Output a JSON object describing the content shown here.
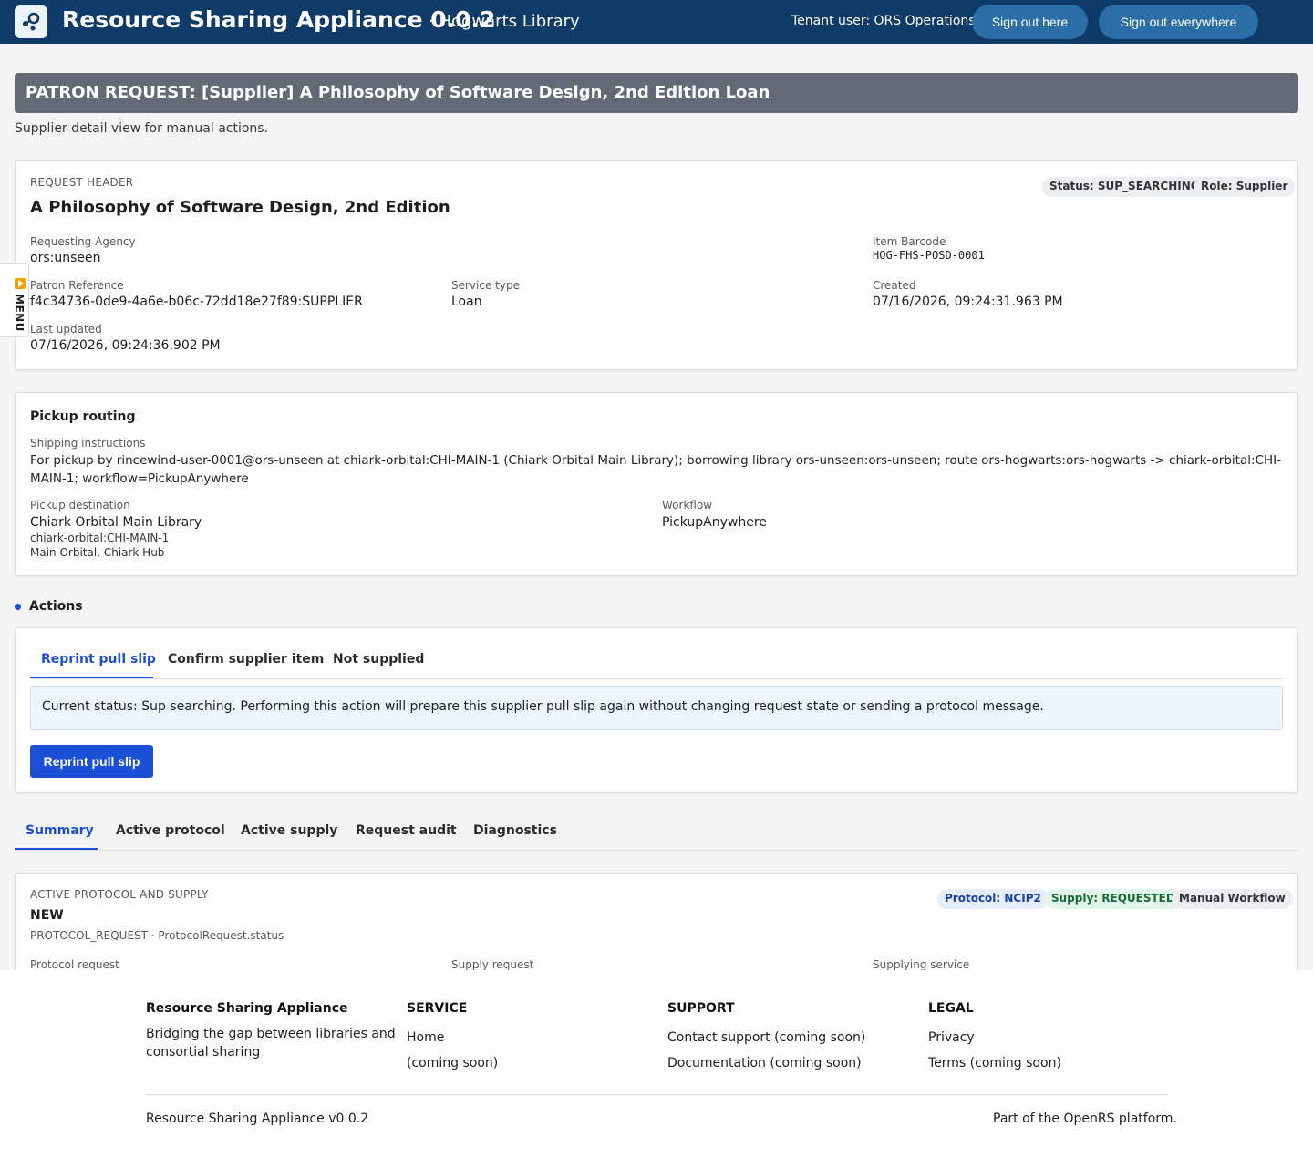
{
  "topbar": {
    "title": "Resource Sharing Appliance 0.0.2",
    "tenant_sep": "· Hogwarts Library",
    "tenant_user": "Tenant user: ORS Operations",
    "signout_here": "Sign out here",
    "signout_everywhere": "Sign out everywhere",
    "logo_icon": "share-nodes-icon"
  },
  "page": {
    "header": "PATRON REQUEST: [Supplier] A Philosophy of Software Design, 2nd Edition Loan",
    "subtitle": "Supplier detail view for manual actions."
  },
  "menu": {
    "label": "MENU",
    "icon": "play-icon"
  },
  "request_header": {
    "section": "REQUEST HEADER",
    "title": "A Philosophy of Software Design, 2nd Edition",
    "status_badge": "Status: SUP_SEARCHING",
    "role_badge": "Role: Supplier",
    "requesting_agency_label": "Requesting Agency",
    "requesting_agency": "ors:unseen",
    "item_barcode_label": "Item Barcode",
    "item_barcode": "HOG-FHS-POSD-0001",
    "patron_reference_label": "Patron Reference",
    "patron_reference": "f4c34736-0de9-4a6e-b06c-72dd18e27f89:SUPPLIER",
    "service_type_label": "Service type",
    "service_type": "Loan",
    "created_label": "Created",
    "created": "07/16/2026, 09:24:31.963 PM",
    "last_updated_label": "Last updated",
    "last_updated": "07/16/2026, 09:24:36.902 PM"
  },
  "pickup": {
    "title": "Pickup routing",
    "shipping_label": "Shipping instructions",
    "shipping_line1": "For pickup by rincewind-user-0001@ors-unseen at chiark-orbital:CHI-MAIN-1 (Chiark Orbital Main Library); borrowing library ors-unseen:ors-unseen; route ors-hogwarts:ors-hogwarts -> chiark-orbital:CHI-",
    "shipping_line2": "MAIN-1; workflow=PickupAnywhere",
    "destination_label": "Pickup destination",
    "destination_name": "Chiark Orbital Main Library",
    "destination_code": "chiark-orbital:CHI-MAIN-1",
    "destination_address": "Main Orbital, Chiark Hub",
    "workflow_label": "Workflow",
    "workflow": "PickupAnywhere"
  },
  "actions": {
    "heading": "Actions",
    "tabs": [
      "Reprint pull slip",
      "Confirm supplier item",
      "Not supplied"
    ],
    "notice": "Current status: Sup searching. Performing this action will prepare this supplier pull slip again without changing request state or sending a protocol message.",
    "button": "Reprint pull slip"
  },
  "detail_tabs": [
    "Summary",
    "Active protocol",
    "Active supply",
    "Request audit",
    "Diagnostics"
  ],
  "summary": {
    "section": "ACTIVE PROTOCOL AND SUPPLY",
    "state": "NEW",
    "source": "PROTOCOL_REQUEST · ProtocolRequest.status",
    "protocol_badge": "Protocol: NCIP2",
    "supply_badge": "Supply: REQUESTED",
    "workflow_badge": "Manual Workflow",
    "col1_label": "Protocol request",
    "col2_label": "Supply request",
    "col3_label": "Supplying service"
  },
  "footer": {
    "brand": "Resource Sharing Appliance",
    "tagline_line1": "Bridging the gap between libraries and",
    "tagline_line2": "consortial sharing",
    "service_title": "SERVICE",
    "service_items": [
      "Home",
      "(coming soon)"
    ],
    "support_title": "SUPPORT",
    "support_items": [
      "Contact support (coming soon)",
      "Documentation (coming soon)"
    ],
    "legal_title": "LEGAL",
    "legal_items": [
      "Privacy",
      "Terms (coming soon)"
    ],
    "version": "Resource Sharing Appliance v0.0.2",
    "platform": "Part of the OpenRS platform."
  },
  "colors": {
    "topbar": "#0f3b68",
    "accent": "#1b4fd6",
    "header_band": "#636a75"
  }
}
